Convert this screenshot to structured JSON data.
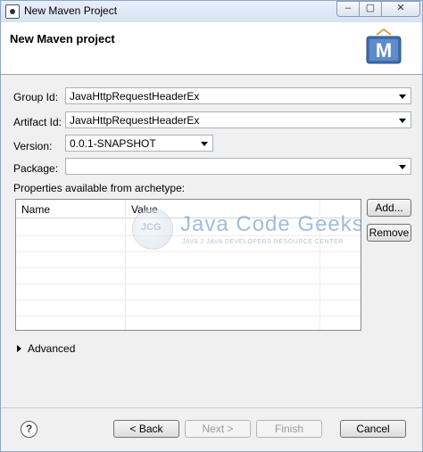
{
  "window": {
    "title": "New Maven Project",
    "controls": {
      "minimize": "–",
      "maximize": "▢",
      "close": "✕"
    }
  },
  "header": {
    "title": "New Maven project",
    "logo_letter": "M"
  },
  "form": {
    "group_id": {
      "label": "Group Id:",
      "value": "JavaHttpRequestHeaderEx"
    },
    "artifact_id": {
      "label": "Artifact Id:",
      "value": "JavaHttpRequestHeaderEx"
    },
    "version": {
      "label": "Version:",
      "value": "0.0.1-SNAPSHOT"
    },
    "package": {
      "label": "Package:",
      "value": ""
    }
  },
  "properties": {
    "label": "Properties available from archetype:",
    "columns": [
      "Name",
      "Value"
    ],
    "add_button": "Add...",
    "remove_button": "Remove"
  },
  "watermark": {
    "badge": "JCG",
    "title": "Java Code Geeks",
    "subtitle": "JAVA 2 JAVA DEVELOPERS RESOURCE CENTER"
  },
  "advanced": {
    "label": "Advanced"
  },
  "footer": {
    "help_icon": "?",
    "back": "< Back",
    "next": "Next >",
    "finish": "Finish",
    "cancel": "Cancel"
  }
}
